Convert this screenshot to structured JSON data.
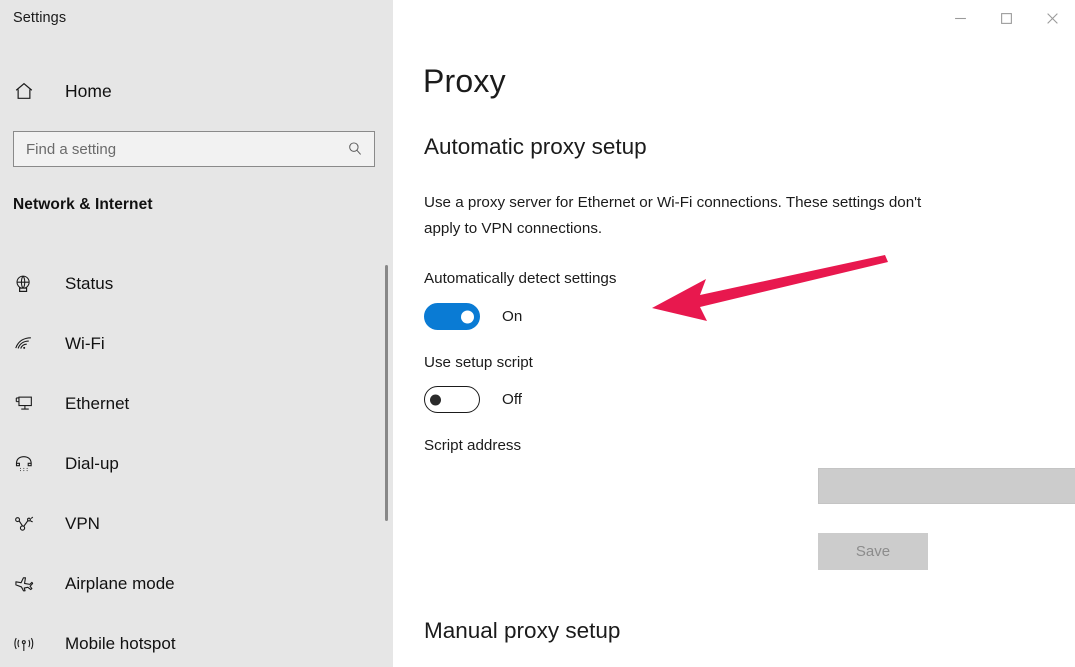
{
  "window": {
    "app_title": "Settings",
    "controls": [
      {
        "name": "minimize",
        "glyph": "minimize-icon",
        "label": "Minimize"
      },
      {
        "name": "maximize",
        "glyph": "maximize-icon",
        "label": "Maximize"
      },
      {
        "name": "close",
        "glyph": "close-icon",
        "label": "Close"
      }
    ]
  },
  "sidebar": {
    "home_label": "Home",
    "home_icon": "home-icon",
    "search": {
      "placeholder": "Find a setting",
      "value": "",
      "icon": "search-icon"
    },
    "category_heading": "Network & Internet",
    "items": [
      {
        "label": "Status",
        "icon": "globe-status-icon"
      },
      {
        "label": "Wi-Fi",
        "icon": "wifi-icon"
      },
      {
        "label": "Ethernet",
        "icon": "ethernet-monitor-icon"
      },
      {
        "label": "Dial-up",
        "icon": "phone-handset-icon"
      },
      {
        "label": "VPN",
        "icon": "vpn-key-icon"
      },
      {
        "label": "Airplane mode",
        "icon": "airplane-icon"
      },
      {
        "label": "Mobile hotspot",
        "icon": "broadcast-tower-icon"
      }
    ]
  },
  "main": {
    "page_title": "Proxy",
    "automatic_section": {
      "heading": "Automatic proxy setup",
      "description": "Use a proxy server for Ethernet or Wi-Fi connections. These settings don't apply to VPN connections.",
      "auto_detect": {
        "label": "Automatically detect settings",
        "state": "On",
        "checked": true
      },
      "use_setup_script": {
        "label": "Use setup script",
        "state": "Off",
        "checked": false
      },
      "script_address": {
        "label": "Script address",
        "value": "",
        "placeholder": "",
        "disabled": true
      },
      "save_label": "Save"
    },
    "manual_section": {
      "heading": "Manual proxy setup"
    }
  },
  "annotation": {
    "arrow_color": "#E8184E",
    "arrow_points_to": "automatically-detect-settings-toggle"
  },
  "colors": {
    "accent_blue": "#0A7BD4",
    "sidebar_bg": "#E6E6E6",
    "content_bg": "#FFFFFF",
    "disabled_gray": "#CCCCCC",
    "arrow_pink": "#E8184E"
  }
}
